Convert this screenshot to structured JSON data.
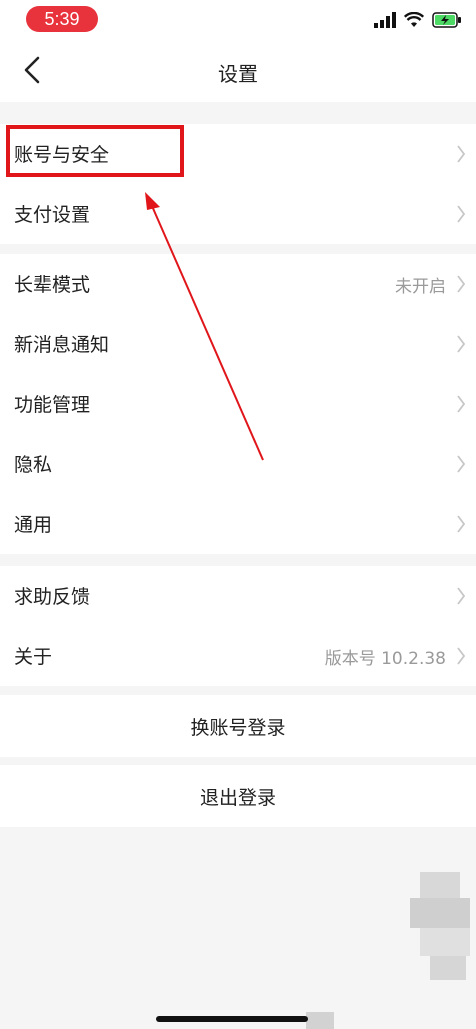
{
  "status": {
    "time": "5:39"
  },
  "nav": {
    "title": "设置"
  },
  "group1": [
    {
      "label": "账号与安全",
      "value": ""
    },
    {
      "label": "支付设置",
      "value": ""
    }
  ],
  "group2": [
    {
      "label": "长辈模式",
      "value": "未开启"
    },
    {
      "label": "新消息通知",
      "value": ""
    },
    {
      "label": "功能管理",
      "value": ""
    },
    {
      "label": "隐私",
      "value": ""
    },
    {
      "label": "通用",
      "value": ""
    }
  ],
  "group3": [
    {
      "label": "求助反馈",
      "value": ""
    },
    {
      "label": "关于",
      "value": "版本号 10.2.38"
    }
  ],
  "buttons": {
    "switch_account": "换账号登录",
    "logout": "退出登录"
  },
  "colors": {
    "accent": "#e8323c",
    "highlight": "#e0161b",
    "battery": "#4cd964"
  }
}
